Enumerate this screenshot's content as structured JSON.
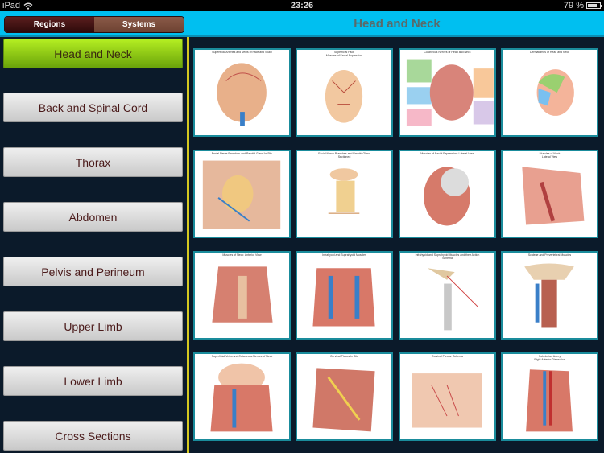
{
  "status_bar": {
    "device": "iPad",
    "time": "23:26",
    "battery_percent_label": "79 %",
    "battery_level": 0.79
  },
  "header": {
    "segments": [
      {
        "label": "Regions",
        "active": true
      },
      {
        "label": "Systems",
        "active": false
      }
    ],
    "title": "Head and Neck"
  },
  "sidebar": {
    "items": [
      {
        "label": "Head and Neck",
        "active": true
      },
      {
        "label": "Back and Spinal Cord",
        "active": false
      },
      {
        "label": "Thorax",
        "active": false
      },
      {
        "label": "Abdomen",
        "active": false
      },
      {
        "label": "Pelvis and Perineum",
        "active": false
      },
      {
        "label": "Upper Limb",
        "active": false
      },
      {
        "label": "Lower Limb",
        "active": false
      },
      {
        "label": "Cross Sections",
        "active": false
      }
    ]
  },
  "plates": [
    {
      "caption": "Superficial Arteries and Veins of Face and Scalp",
      "subcaption": ""
    },
    {
      "caption": "Superficial Face",
      "subcaption": "Muscles of Facial Expression"
    },
    {
      "caption": "Cutaneous Nerves of Head and Neck",
      "subcaption": ""
    },
    {
      "caption": "Dermatomes of Head and Neck",
      "subcaption": ""
    },
    {
      "caption": "Facial Nerve Branches and Parotid Gland In Situ",
      "subcaption": ""
    },
    {
      "caption": "Facial Nerve Branches and Parotid Gland",
      "subcaption": "Sectioned"
    },
    {
      "caption": "Muscles of Facial Expression: Lateral View",
      "subcaption": ""
    },
    {
      "caption": "Muscles of Neck",
      "subcaption": "Lateral View"
    },
    {
      "caption": "Muscles of Neck: Anterior View",
      "subcaption": ""
    },
    {
      "caption": "Infrahyoid and Suprahyoid Muscles",
      "subcaption": ""
    },
    {
      "caption": "Infrahyoid and Suprahyoid Muscles and their Action",
      "subcaption": "Schema"
    },
    {
      "caption": "Scalene and Prevertebral Muscles",
      "subcaption": ""
    },
    {
      "caption": "Superficial Veins and Cutaneous Nerves of Neck",
      "subcaption": ""
    },
    {
      "caption": "Cervical Plexus In Situ",
      "subcaption": ""
    },
    {
      "caption": "Cervical Plexus: Schema",
      "subcaption": ""
    },
    {
      "caption": "Subclavian Artery",
      "subcaption": "Right Anterior Dissection"
    }
  ],
  "colors": {
    "header_bg": "#00bff0",
    "sidebar_bg": "#0b1a2a",
    "active_item": "#9ad416",
    "divider": "#d4c820",
    "tile_border": "#1a8c9c",
    "item_text": "#4a1a1a"
  }
}
